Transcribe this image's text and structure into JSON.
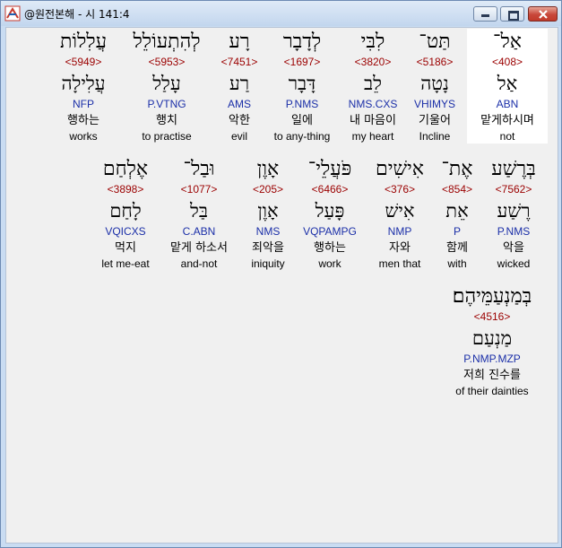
{
  "window": {
    "title": "@원전본해 - 시 141:4"
  },
  "words": [
    {
      "hebrew": "אַל־",
      "strong": "<408>",
      "lemma": "אַל",
      "morph": "ABN",
      "korean": "맡게하시며",
      "english": "not"
    },
    {
      "hebrew": "תַּט־",
      "strong": "<5186>",
      "lemma": "נָטָה",
      "morph": "VHIMYS",
      "korean": "기울어",
      "english": "Incline"
    },
    {
      "hebrew": "לִבִּי",
      "strong": "<3820>",
      "lemma": "לֵב",
      "morph": "NMS.CXS",
      "korean": "내 마음이",
      "english": "my heart"
    },
    {
      "hebrew": "לְדָבָר",
      "strong": "<1697>",
      "lemma": "דָּבָר",
      "morph": "P.NMS",
      "korean": "일에",
      "english": "to any-thing"
    },
    {
      "hebrew": "רָע",
      "strong": "<7451>",
      "lemma": "רַע",
      "morph": "AMS",
      "korean": "악한",
      "english": "evil"
    },
    {
      "hebrew": "לְהִתְעוֹלֵל",
      "strong": "<5953>",
      "lemma": "עָלַל",
      "morph": "P.VTNG",
      "korean": "행치",
      "english": "to practise"
    },
    {
      "hebrew": "עֲלִלוֹת",
      "strong": "<5949>",
      "lemma": "עֲלִילָה",
      "morph": "NFP",
      "korean": "행하는",
      "english": "works"
    },
    {
      "hebrew": "בְּרֶשַׁע",
      "strong": "<7562>",
      "lemma": "רֶשַׁע",
      "morph": "P.NMS",
      "korean": "악을",
      "english": "wicked"
    },
    {
      "hebrew": "אֶת־",
      "strong": "<854>",
      "lemma": "אֵת",
      "morph": "P",
      "korean": "함께",
      "english": "with"
    },
    {
      "hebrew": "אִישִׁים",
      "strong": "<376>",
      "lemma": "אִישׁ",
      "morph": "NMP",
      "korean": "자와",
      "english": "men that"
    },
    {
      "hebrew": "פֹּעֲלֵי־",
      "strong": "<6466>",
      "lemma": "פָּעַל",
      "morph": "VQPAMPG",
      "korean": "행하는",
      "english": "work"
    },
    {
      "hebrew": "אָוֶן",
      "strong": "<205>",
      "lemma": "אָוֶן",
      "morph": "NMS",
      "korean": "죄악을",
      "english": "iniquity"
    },
    {
      "hebrew": "וּבַל־",
      "strong": "<1077>",
      "lemma": "בַּל",
      "morph": "C.ABN",
      "korean": "맡게 하소서",
      "english": "and-not"
    },
    {
      "hebrew": "אֶלְחַם",
      "strong": "<3898>",
      "lemma": "לָחַם",
      "morph": "VQICXS",
      "korean": "먹지",
      "english": "let me-eat"
    },
    {
      "hebrew": "בְּמַנְעַמֵּיהֶם׃",
      "strong": "<4516>",
      "lemma": "מַנְעַם",
      "morph": "P.NMP.MZP",
      "korean": "저희 진수를",
      "english": "of their dainties"
    }
  ]
}
